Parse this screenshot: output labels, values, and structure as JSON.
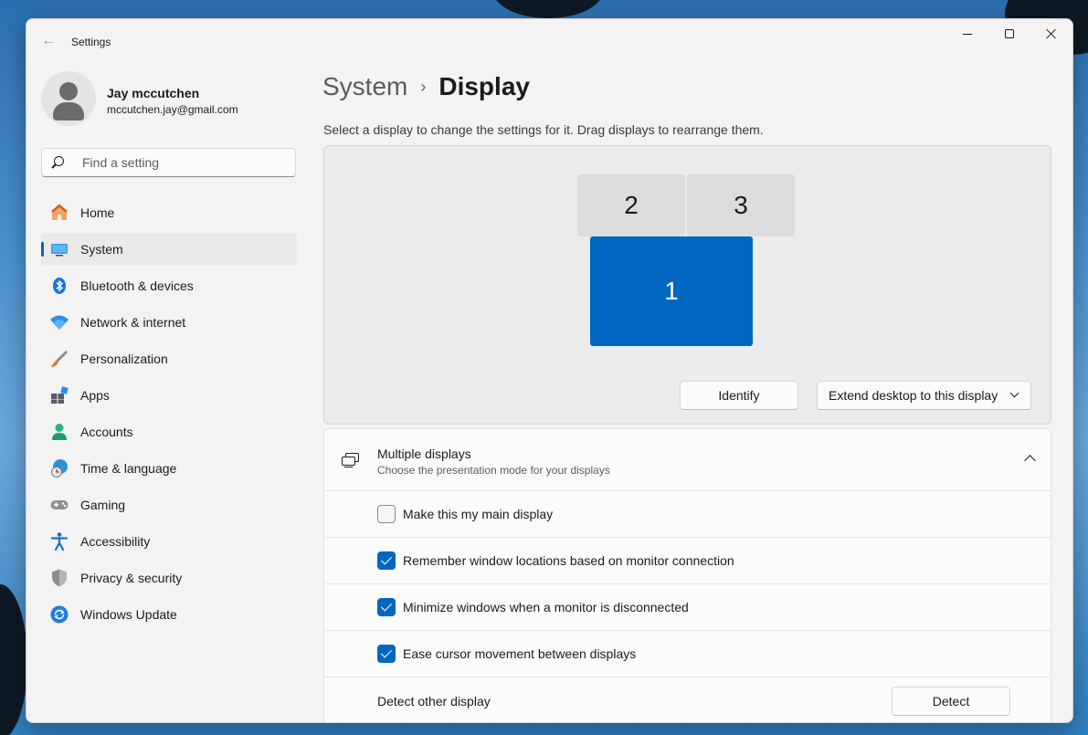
{
  "window": {
    "title": "Settings"
  },
  "profile": {
    "name": "Jay mccutchen",
    "email": "mccutchen.jay@gmail.com"
  },
  "search": {
    "placeholder": "Find a setting"
  },
  "nav": [
    {
      "label": "Home",
      "icon": "home-icon",
      "active": false
    },
    {
      "label": "System",
      "icon": "system-icon",
      "active": true
    },
    {
      "label": "Bluetooth & devices",
      "icon": "bluetooth-icon",
      "active": false
    },
    {
      "label": "Network & internet",
      "icon": "wifi-icon",
      "active": false
    },
    {
      "label": "Personalization",
      "icon": "brush-icon",
      "active": false
    },
    {
      "label": "Apps",
      "icon": "apps-icon",
      "active": false
    },
    {
      "label": "Accounts",
      "icon": "accounts-icon",
      "active": false
    },
    {
      "label": "Time & language",
      "icon": "globe-clock-icon",
      "active": false
    },
    {
      "label": "Gaming",
      "icon": "gamepad-icon",
      "active": false
    },
    {
      "label": "Accessibility",
      "icon": "accessibility-icon",
      "active": false
    },
    {
      "label": "Privacy & security",
      "icon": "shield-icon",
      "active": false
    },
    {
      "label": "Windows Update",
      "icon": "update-icon",
      "active": false
    }
  ],
  "breadcrumb": {
    "parent": "System",
    "current": "Display"
  },
  "description": "Select a display to change the settings for it. Drag displays to rearrange them.",
  "displays": {
    "monitors": [
      {
        "id": "2",
        "selected": false
      },
      {
        "id": "3",
        "selected": false
      },
      {
        "id": "1",
        "selected": true
      }
    ],
    "identify_label": "Identify",
    "mode_label": "Extend desktop to this display"
  },
  "multiple_displays": {
    "title": "Multiple displays",
    "subtitle": "Choose the presentation mode for your displays",
    "options": [
      {
        "label": "Make this my main display",
        "checked": false
      },
      {
        "label": "Remember window locations based on monitor connection",
        "checked": true
      },
      {
        "label": "Minimize windows when a monitor is disconnected",
        "checked": true
      },
      {
        "label": "Ease cursor movement between displays",
        "checked": true
      }
    ],
    "detect_label": "Detect other display",
    "detect_button": "Detect"
  },
  "colors": {
    "accent": "#0067c0",
    "window_bg": "#f3f3f3",
    "card_bg": "#fbfbfb"
  }
}
